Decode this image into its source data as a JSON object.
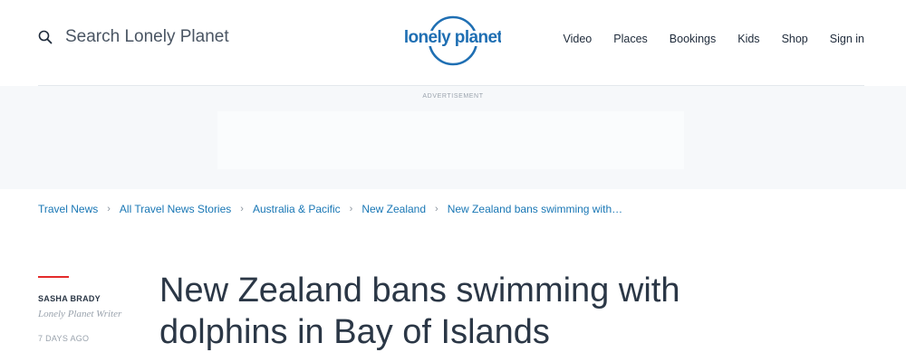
{
  "header": {
    "search": {
      "placeholder": "Search Lonely Planet",
      "icon": "search-icon"
    },
    "logo": {
      "line1": "lonely planet",
      "color": "#1f6fb3"
    },
    "nav": [
      {
        "label": "Video"
      },
      {
        "label": "Places"
      },
      {
        "label": "Bookings"
      },
      {
        "label": "Kids"
      },
      {
        "label": "Shop"
      },
      {
        "label": "Sign in"
      }
    ]
  },
  "ad": {
    "label": "ADVERTISEMENT"
  },
  "breadcrumb": [
    {
      "label": "Travel News"
    },
    {
      "label": "All Travel News Stories"
    },
    {
      "label": "Australia & Pacific"
    },
    {
      "label": "New Zealand"
    },
    {
      "label": "New Zealand bans swimming with…"
    }
  ],
  "breadcrumb_separator": "›",
  "article": {
    "author_name": "SASHA BRADY",
    "author_role": "Lonely Planet Writer",
    "date": "7 DAYS AGO",
    "headline_line1": "New Zealand bans swimming with",
    "headline_line2": "dolphins in Bay of Islands"
  },
  "colors": {
    "accent_red": "#e42b2b",
    "link_blue": "#1977b5",
    "text_dark": "#2b3746"
  }
}
